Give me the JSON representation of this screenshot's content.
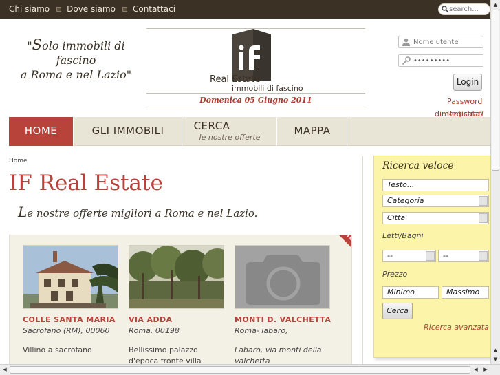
{
  "topnav": {
    "items": [
      "Chi siamo",
      "Dove siamo",
      "Contattaci"
    ],
    "search_placeholder": "search..."
  },
  "header": {
    "slogan_quote_open": "\"",
    "slogan_cap": "S",
    "slogan_rest1": "olo immobili di",
    "slogan_line2": "fascino",
    "slogan_line3": "a Roma e nel Lazio\"",
    "brand": "Real Estate",
    "brand_sub": "immobili di fascino",
    "date": "Domenica 05 Giugno 2011"
  },
  "login": {
    "username_placeholder": "Nome utente",
    "password_value": "•••••••••",
    "button": "Login",
    "forgot_label": "Password",
    "forgot_label2": "dimenticata?",
    "register_label": "Registrati"
  },
  "menu": {
    "items": [
      {
        "label": "HOME"
      },
      {
        "label": "GLI IMMOBILI"
      },
      {
        "label": "CERCA",
        "sub": "le nostre offerte"
      },
      {
        "label": "MAPPA"
      }
    ]
  },
  "main": {
    "breadcrumb": "Home",
    "title": "IF Real Estate",
    "subtitle_cap": "L",
    "subtitle_rest": "e nostre offerte migliori a Roma e nel Lazio."
  },
  "offers": {
    "ribbon": "TOP",
    "cards": [
      {
        "name": "COLLE SANTA MARIA",
        "location": "Sacrofano (RM), 00060",
        "description": "Villino a sacrofano"
      },
      {
        "name": "VIA ADDA",
        "location": "Roma, 00198",
        "description": "Bellissimo palazzo d'epoca fronte villa albani"
      },
      {
        "name": "MONTI D. VALCHETTA",
        "location": "Roma- labaro,",
        "description": "Labaro, via monti della valchetta"
      }
    ]
  },
  "quick_search": {
    "title": "Ricerca veloce",
    "text_field": "Testo...",
    "category": "Categoria",
    "city": "Citta'",
    "beds_label": "Letti/Bagni",
    "beds_value": "--",
    "baths_value": "--",
    "price_label": "Prezzo",
    "min": "Minimo",
    "max": "Massimo",
    "button": "Cerca",
    "advanced": "Ricerca avanzata"
  },
  "colors": {
    "accent": "#b8433a",
    "topbar": "#3b3124",
    "menu_bg": "#e8e4d6",
    "quick_bg": "#fcf4a8"
  }
}
